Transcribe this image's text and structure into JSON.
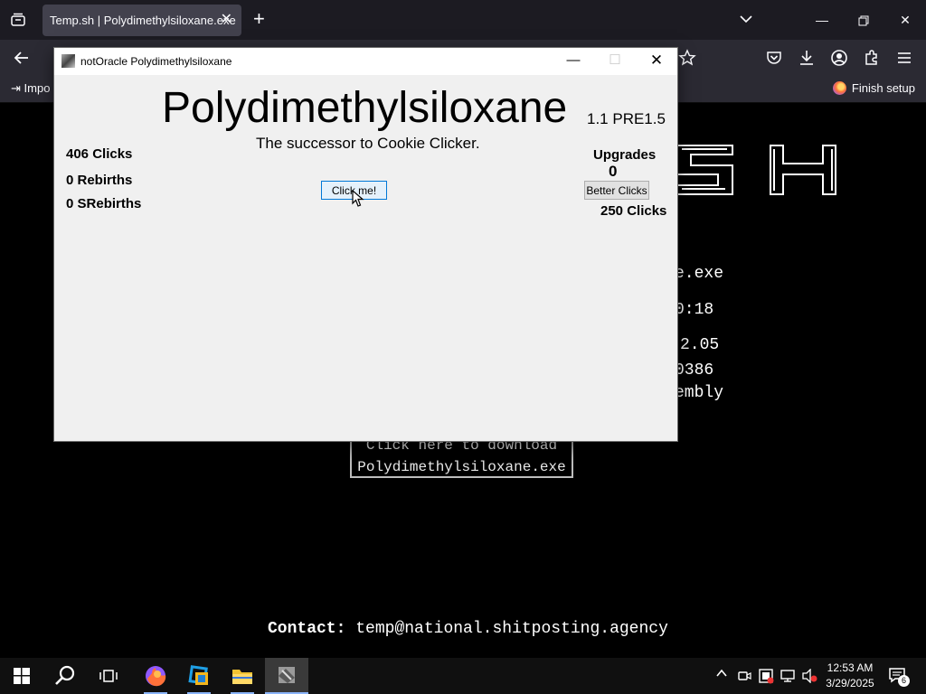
{
  "browser": {
    "tab_title": "Temp.sh | Polydimethylsiloxane.exe",
    "bookmark_import": "Impo",
    "finish_setup": "Finish setup"
  },
  "page": {
    "info_lines": [
      "e.exe",
      "0:18",
      "2.05",
      "0386",
      "embly"
    ],
    "download_line1": "Click here to download",
    "download_line2": "Polydimethylsiloxane.exe",
    "contact_label": "Contact:",
    "contact_email": "temp@national.shitposting.agency"
  },
  "app": {
    "window_title": "notOracle Polydimethylsiloxane",
    "title": "Polydimethylsiloxane",
    "version": "1.1 PRE1.5",
    "subtitle": "The successor to Cookie Clicker.",
    "clicks": "406 Clicks",
    "rebirths": "0 Rebirths",
    "srebirths": "0 SRebirths",
    "click_button": "Click me!",
    "upgrades_heading": "Upgrades",
    "upgrades_count": "0",
    "better_clicks_button": "Better Clicks",
    "better_clicks_cost": "250 Clicks"
  },
  "taskbar": {
    "apps": [
      "start-icon",
      "search-icon",
      "task-view-icon",
      "firefox-icon",
      "virtualbox-icon",
      "file-explorer-icon",
      "polydimethylsiloxane-app-icon"
    ],
    "time": "12:53 AM",
    "date": "3/29/2025",
    "notification_count": "6"
  },
  "colors": {
    "tab_bar": "#1c1b22",
    "toolbar": "#2b2a33",
    "page_background": "#000000",
    "app_background": "#f0f0f0",
    "button_focus_border": "#0078d7",
    "taskbar": "#101010"
  }
}
